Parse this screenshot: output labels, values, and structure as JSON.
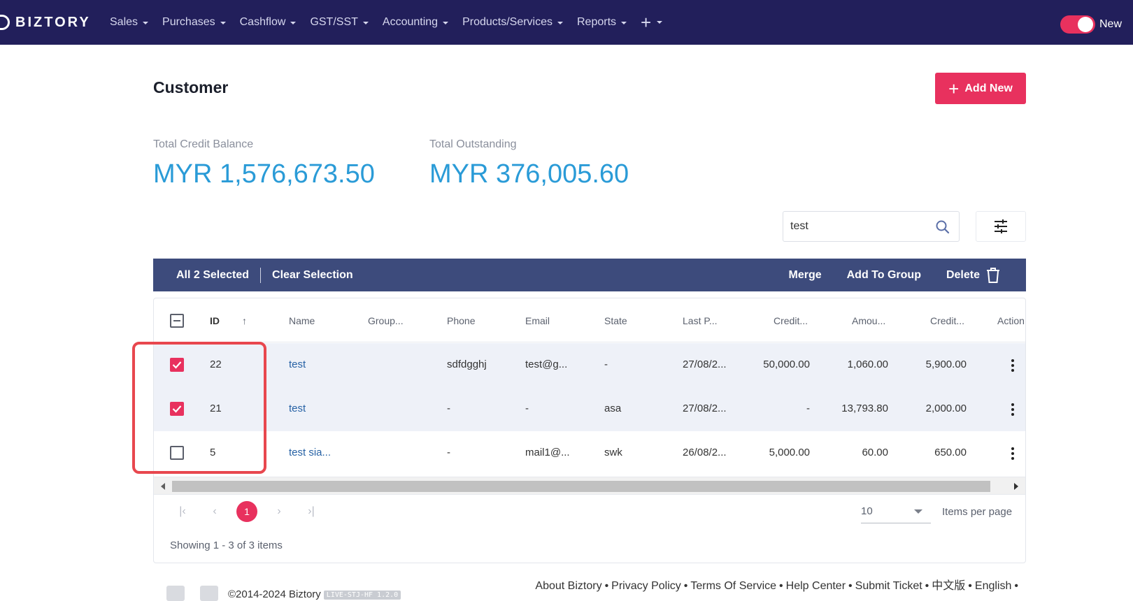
{
  "nav": {
    "logo_text": "BIZTORY",
    "items": [
      {
        "label": "Sales"
      },
      {
        "label": "Purchases"
      },
      {
        "label": "Cashflow"
      },
      {
        "label": "GST/SST"
      },
      {
        "label": "Accounting"
      },
      {
        "label": "Products/Services"
      },
      {
        "label": "Reports"
      }
    ],
    "plus_symbol": "+",
    "toggle_label": "New"
  },
  "page": {
    "title": "Customer",
    "add_button_label": "Add New",
    "add_button_symbol": "+"
  },
  "stats": {
    "credit_label": "Total Credit Balance",
    "credit_value": "MYR 1,576,673.50",
    "outstanding_label": "Total Outstanding",
    "outstanding_value": "MYR 376,005.60"
  },
  "search": {
    "value": "test",
    "icon": "search-icon"
  },
  "selection_bar": {
    "selected_label": "All 2 Selected",
    "clear_label": "Clear Selection",
    "merge_label": "Merge",
    "add_group_label": "Add To Group",
    "delete_label": "Delete"
  },
  "table": {
    "headers": {
      "id": "ID",
      "sort_arrow": "↑",
      "name": "Name",
      "group": "Group...",
      "phone": "Phone",
      "email": "Email",
      "state": "State",
      "last_p": "Last P...",
      "credit1": "Credit...",
      "amount": "Amou...",
      "credit2": "Credit...",
      "action": "Action"
    },
    "rows": [
      {
        "selected": true,
        "id": "22",
        "name": "test",
        "group": "",
        "phone": "sdfdgghj",
        "email": "test@g...",
        "state": "-",
        "last_p": "27/08/2...",
        "credit1": "50,000.00",
        "amount": "1,060.00",
        "credit2": "5,900.00"
      },
      {
        "selected": true,
        "id": "21",
        "name": "test",
        "group": "",
        "phone": "-",
        "email": "-",
        "state": "asa",
        "last_p": "27/08/2...",
        "credit1": "-",
        "amount": "13,793.80",
        "credit2": "2,000.00"
      },
      {
        "selected": false,
        "id": "5",
        "name": "test sia...",
        "group": "",
        "phone": "-",
        "email": "mail1@...",
        "state": "swk",
        "last_p": "26/08/2...",
        "credit1": "5,000.00",
        "amount": "60.00",
        "credit2": "650.00"
      }
    ]
  },
  "pager": {
    "first": "|‹",
    "prev": "‹",
    "current_page": "1",
    "next": "›",
    "last": "›|",
    "per_page_value": "10",
    "per_page_label": "Items per page",
    "showing": "Showing 1 - 3 of 3 items"
  },
  "footer": {
    "links": [
      "About Biztory",
      "Privacy Policy",
      "Terms Of Service",
      "Help Center",
      "Submit Ticket",
      "中文版",
      "English"
    ],
    "separator": "•",
    "copyright": "©2014-2024 Biztory",
    "version": "LIVE-STJ-HF 1.2.0"
  },
  "colors": {
    "navbar": "#221f5b",
    "accent": "#e8315e",
    "stat_value": "#2a9bd7",
    "selection_bar": "#3d4b7c",
    "link": "#2762a5",
    "highlight_box": "#e8474e"
  }
}
